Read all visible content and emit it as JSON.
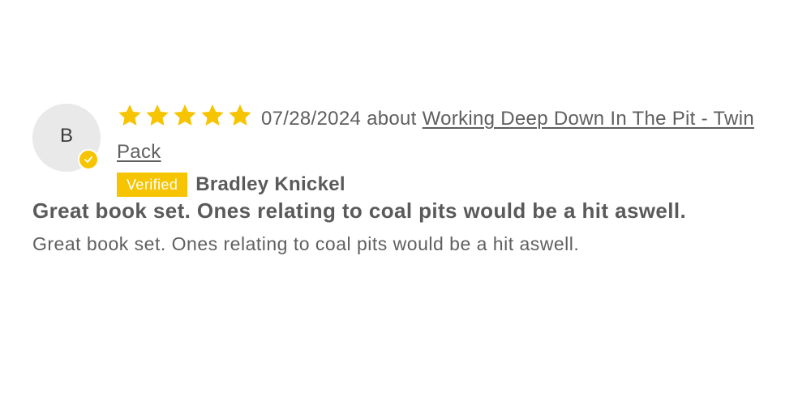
{
  "review": {
    "avatar_initial": "B",
    "rating": 5,
    "max_rating": 5,
    "star_color": "#f6c400",
    "date": "07/28/2024",
    "about_label": "about",
    "product_name": "Working Deep Down In The Pit - Twin Pack",
    "verified_label": "Verified",
    "reviewer_name": "Bradley Knickel",
    "title": "Great book set. Ones relating to coal pits would be a hit aswell.",
    "body": "Great book set. Ones relating to coal pits would be a hit aswell."
  }
}
